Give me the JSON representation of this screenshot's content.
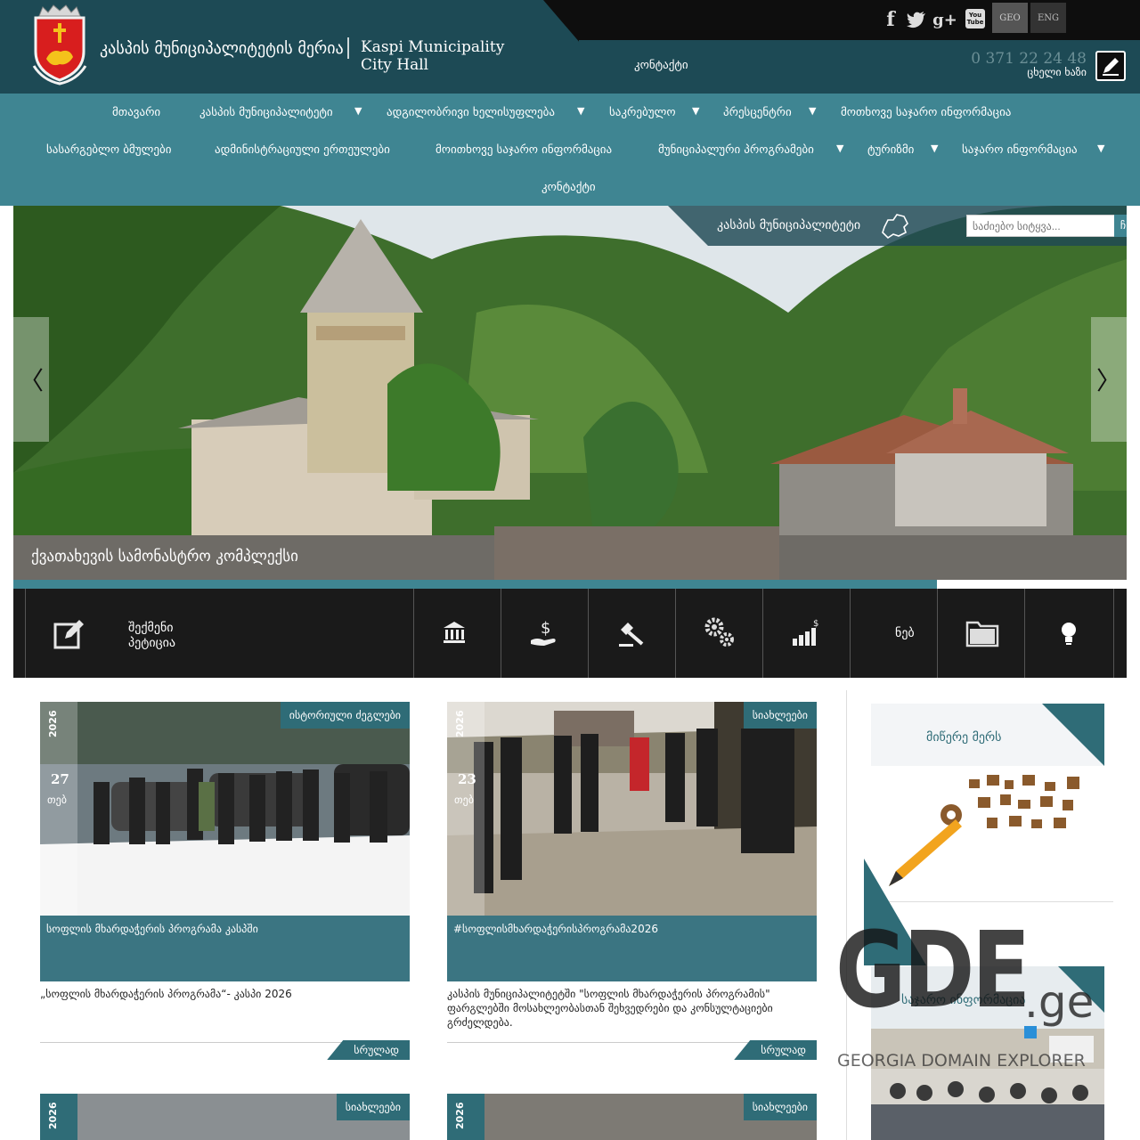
{
  "header": {
    "title_ge": "კასპის მუნიციპალიტეტის მერია",
    "title_en": "Kaspi Municipality City Hall",
    "social": {
      "facebook": "f",
      "twitter": "t",
      "google": "g+",
      "youtube": "You Tube"
    },
    "languages": [
      "GEO",
      "ENG"
    ],
    "contact_label": "კონტაქტი",
    "phone": "0 371 22 24 48",
    "hotline_label": "ცხელი ხაზი"
  },
  "nav": {
    "row1": [
      "მთავარი",
      "კასპის მუნიციპალიტეტი",
      "ადგილობრივი ხელისუფლება",
      "საკრებულო",
      "პრესცენტრი",
      "მოთხოვე საჯარო ინფორმაცია"
    ],
    "row2": [
      "სასარგებლო ბმულები",
      "ადმინისტრაციული ერთეულები",
      "მოითხოვე საჯარო ინფორმაცია",
      "მუნიციპალური პროგრამები",
      "ტურიზმი",
      "საჯარო ინფორმაცია"
    ],
    "row3": [
      "კონტაქტი"
    ]
  },
  "slider": {
    "section_label": "კასპის მუნიციპალიტეტი",
    "search_placeholder": "საძიებო სიტყვა...",
    "search_button": "ჩ",
    "prev": "〈",
    "next": "〉",
    "caption": "ქვათახევის სამონასტრო კომპლექსი"
  },
  "quick": {
    "petition_label_1": "შექმენი",
    "petition_label_2": "პეტიცია",
    "truncated_label": "ნებ"
  },
  "cards": [
    {
      "year": "2026",
      "day": "27",
      "weekday": "თებ",
      "tag": "ისტორიული ძეგლები",
      "title": "სოფლის მხარდაჭერის პროგრამა კასპში",
      "desc": "„სოფლის მხარდაჭერის პროგრამა“- კასპი 2026",
      "more": "სრულად"
    },
    {
      "year": "2026",
      "day": "23",
      "weekday": "თებ",
      "tag": "სიახლეები",
      "title": "#სოფლისმხარდაჭერისპროგრამა2026",
      "desc": "კასპის მუნიციპალიტეტში \"სოფლის მხარდაჭერის პროგრამის\" ფარგლებში მოსახლეობასთან შეხვედრები და კონსულტაციები გრძელდება.",
      "more": "სრულად"
    },
    {
      "year": "2026",
      "tag": "სიახლეები"
    },
    {
      "year": "2026",
      "tag": "სიახლეები"
    }
  ],
  "sidebar": {
    "widget1_title": "მიწერე მერს",
    "widget2_title": "საჯარო ინფორმაცია"
  },
  "watermark": {
    "brand": "GDE",
    "tld": ".ge",
    "tagline": "GEORGIA DOMAIN EXPLORER"
  }
}
